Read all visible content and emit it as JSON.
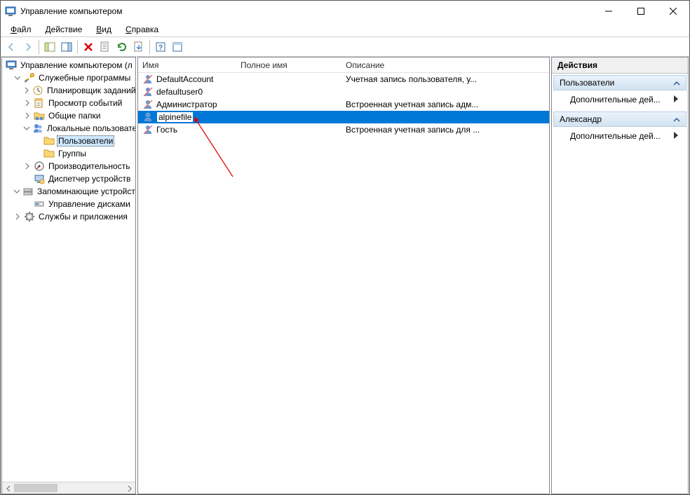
{
  "window": {
    "title": "Управление компьютером"
  },
  "menu": {
    "file": "Файл",
    "action": "Действие",
    "view": "Вид",
    "help": "Справка"
  },
  "tree": {
    "root": "Управление компьютером (л",
    "sys_tools": "Служебные программы",
    "task_sched": "Планировщик заданий",
    "event_viewer": "Просмотр событий",
    "shared": "Общие папки",
    "local_users": "Локальные пользовате",
    "users": "Пользователи",
    "groups": "Группы",
    "perf": "Производительность",
    "devmgr": "Диспетчер устройств",
    "storage": "Запоминающие устройст",
    "diskmgr": "Управление дисками",
    "services": "Службы и приложения"
  },
  "list": {
    "col_name": "Имя",
    "col_full": "Полное имя",
    "col_desc": "Описание",
    "rows": [
      {
        "name": "DefaultAccount",
        "full": "",
        "desc": "Учетная запись пользователя, у..."
      },
      {
        "name": "defaultuser0",
        "full": "",
        "desc": ""
      },
      {
        "name": "Администратор",
        "full": "",
        "desc": "Встроенная учетная запись адм..."
      },
      {
        "name": "alpinefile",
        "full": "",
        "desc": ""
      },
      {
        "name": "Гость",
        "full": "",
        "desc": "Встроенная учетная запись для ..."
      }
    ]
  },
  "actions": {
    "title": "Действия",
    "section1": "Пользователи",
    "more1": "Дополнительные дей...",
    "section2": "Александр",
    "more2": "Дополнительные дей..."
  }
}
